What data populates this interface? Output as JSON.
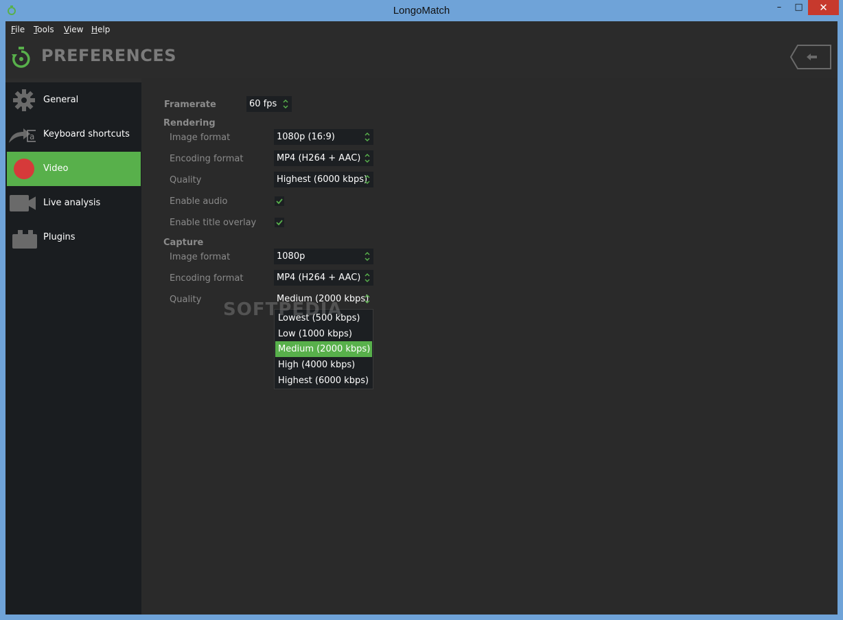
{
  "window": {
    "title": "LongoMatch",
    "close_glyph": "✕",
    "minimize_glyph": "–",
    "maximize_glyph": "□"
  },
  "menubar": {
    "items": [
      "File",
      "Tools",
      "View",
      "Help"
    ]
  },
  "header": {
    "title": "PREFERENCES",
    "back_icon": "back-arrow-icon"
  },
  "sidebar": {
    "items": [
      {
        "label": "General",
        "icon": "gear-icon"
      },
      {
        "label": "Keyboard shortcuts",
        "icon": "keyboard-shortcut-icon"
      },
      {
        "label": "Video",
        "icon": "record-icon",
        "active": true
      },
      {
        "label": "Live analysis",
        "icon": "camera-icon"
      },
      {
        "label": "Plugins",
        "icon": "plugin-icon"
      }
    ]
  },
  "video": {
    "framerate": {
      "label": "Framerate",
      "value": "60 fps"
    },
    "rendering": {
      "label": "Rendering",
      "image_format": {
        "label": "Image format",
        "value": "1080p (16:9)"
      },
      "encoding_format": {
        "label": "Encoding format",
        "value": "MP4 (H264 + AAC)"
      },
      "quality": {
        "label": "Quality",
        "value": "Highest (6000 kbps)"
      },
      "enable_audio": {
        "label": "Enable audio",
        "checked": true
      },
      "enable_title_overlay": {
        "label": "Enable title overlay",
        "checked": true
      }
    },
    "capture": {
      "label": "Capture",
      "image_format": {
        "label": "Image format",
        "value": "1080p"
      },
      "encoding_format": {
        "label": "Encoding format",
        "value": "MP4 (H264 + AAC)"
      },
      "quality": {
        "label": "Quality",
        "value": "Medium (2000 kbps)"
      }
    }
  },
  "dropdown": {
    "options": [
      "Lowest (500 kbps)",
      "Low (1000 kbps)",
      "Medium (2000 kbps)",
      "High (4000 kbps)",
      "Highest (6000 kbps)"
    ],
    "selected": "Medium (2000 kbps)"
  },
  "watermark": "SOFTPEDIA",
  "colors": {
    "accent": "#58b04b",
    "record_red": "#d63a3a",
    "background": "#2a2a2a"
  }
}
